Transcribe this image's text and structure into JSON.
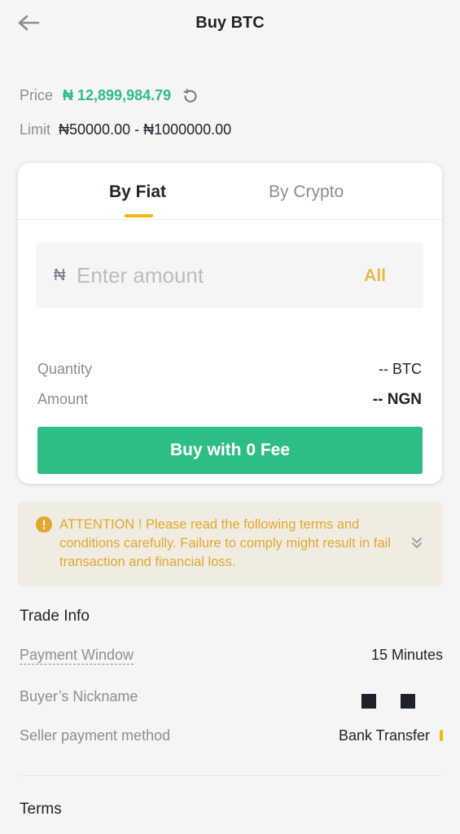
{
  "header": {
    "title": "Buy BTC",
    "back_icon": "arrow-left-icon"
  },
  "price": {
    "label": "Price",
    "value": "₦ 12,899,984.79",
    "refresh_icon": "refresh-icon",
    "color": "#2ebd85"
  },
  "limit": {
    "label": "Limit",
    "value": "₦50000.00 - ₦1000000.00"
  },
  "tabs": [
    {
      "label": "By Fiat",
      "active": true
    },
    {
      "label": "By Crypto",
      "active": false
    }
  ],
  "amount": {
    "currency_symbol": "₦",
    "placeholder": "Enter amount",
    "value": "",
    "all_label": "All"
  },
  "quantity": {
    "label": "Quantity",
    "value": "-- BTC"
  },
  "amount_summary": {
    "label": "Amount",
    "value": "-- NGN"
  },
  "buy_button": {
    "label": "Buy with 0 Fee",
    "color": "#2ebd85"
  },
  "attention": {
    "text": "ATTENTION ! Please read the following terms and conditions carefully. Failure to comply might result in fail transaction and financial loss.",
    "color": "#e0a82f"
  },
  "trade_info": {
    "title": "Trade Info",
    "rows": [
      {
        "label": "Payment Window",
        "value": "15 Minutes"
      },
      {
        "label": "Buyer’s Nickname",
        "value": ""
      },
      {
        "label": "Seller payment method",
        "value": "Bank Transfer"
      }
    ]
  },
  "terms": {
    "title": "Terms"
  },
  "accent_color": "#f0b90b"
}
